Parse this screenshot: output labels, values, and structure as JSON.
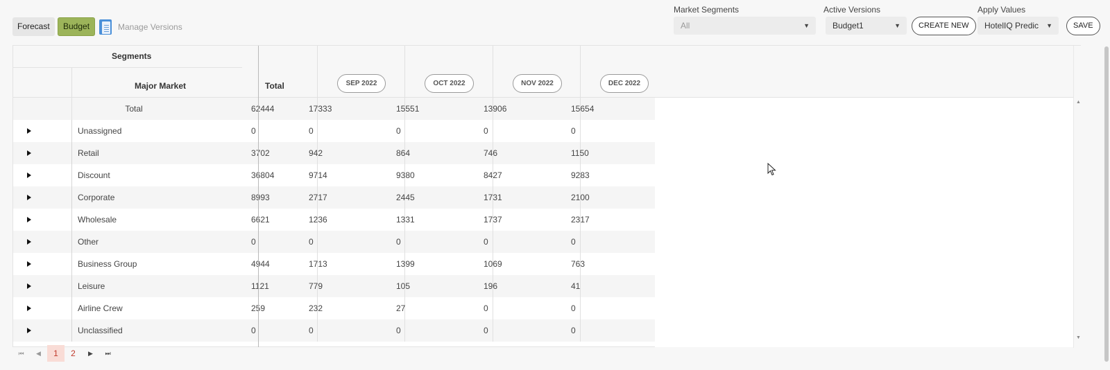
{
  "toolbar": {
    "forecast_label": "Forecast",
    "budget_label": "Budget",
    "manage_label": "Manage Versions",
    "market_segments_label": "Market Segments",
    "market_segments_value": "All",
    "active_versions_label": "Active Versions",
    "active_versions_value": "Budget1",
    "create_new_label": "CREATE NEW",
    "apply_values_label": "Apply Values",
    "apply_values_value": "HotelIQ Predic",
    "save_label": "SAVE",
    "accent_color": "#9cb45a"
  },
  "grid": {
    "group_header": "Segments",
    "major_market_header": "Major Market",
    "total_header": "Total",
    "months": [
      "SEP 2022",
      "OCT 2022",
      "NOV 2022",
      "DEC 2022"
    ],
    "total_row": {
      "label": "Total",
      "total": "62444",
      "values": [
        "17333",
        "15551",
        "13906",
        "15654"
      ]
    },
    "rows": [
      {
        "label": "Unassigned",
        "total": "0",
        "values": [
          "0",
          "0",
          "0",
          "0"
        ]
      },
      {
        "label": "Retail",
        "total": "3702",
        "values": [
          "942",
          "864",
          "746",
          "1150"
        ]
      },
      {
        "label": "Discount",
        "total": "36804",
        "values": [
          "9714",
          "9380",
          "8427",
          "9283"
        ]
      },
      {
        "label": "Corporate",
        "total": "8993",
        "values": [
          "2717",
          "2445",
          "1731",
          "2100"
        ]
      },
      {
        "label": "Wholesale",
        "total": "6621",
        "values": [
          "1236",
          "1331",
          "1737",
          "2317"
        ]
      },
      {
        "label": "Other",
        "total": "0",
        "values": [
          "0",
          "0",
          "0",
          "0"
        ]
      },
      {
        "label": "Business Group",
        "total": "4944",
        "values": [
          "1713",
          "1399",
          "1069",
          "763"
        ]
      },
      {
        "label": "Leisure",
        "total": "1121",
        "values": [
          "779",
          "105",
          "196",
          "41"
        ]
      },
      {
        "label": "Airline Crew",
        "total": "259",
        "values": [
          "232",
          "27",
          "0",
          "0"
        ]
      },
      {
        "label": "Unclassified",
        "total": "0",
        "values": [
          "0",
          "0",
          "0",
          "0"
        ]
      }
    ]
  },
  "pager": {
    "pages": [
      "1",
      "2"
    ],
    "current_page": "1"
  }
}
